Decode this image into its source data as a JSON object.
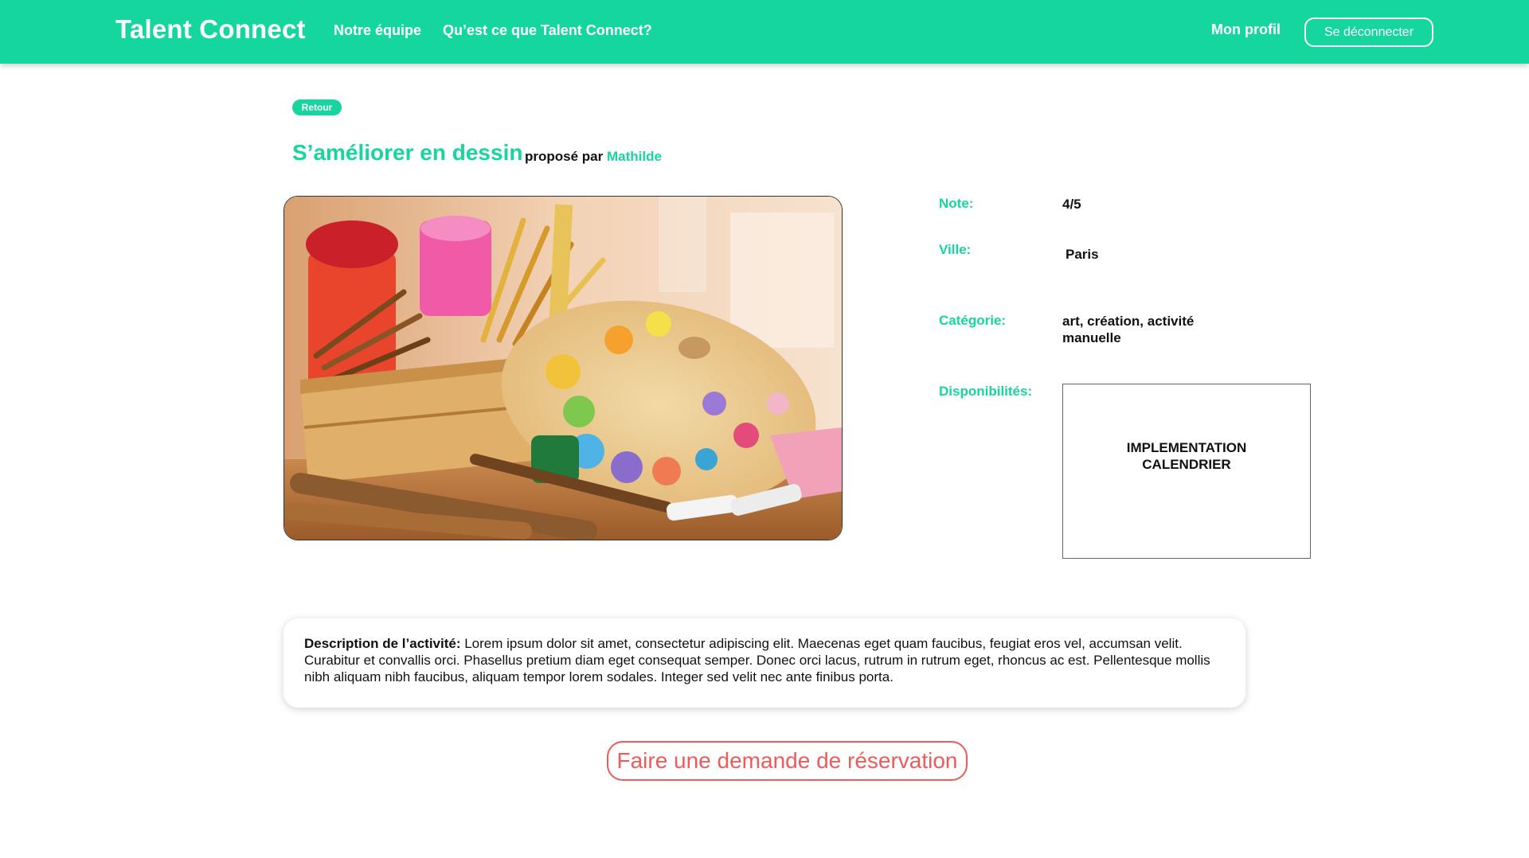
{
  "header": {
    "brand": "Talent Connect",
    "nav": {
      "team": "Notre équipe",
      "about": "Qu’est ce que Talent Connect?"
    },
    "profile": "Mon profil",
    "logout": "Se déconnecter"
  },
  "back_label": "Retour",
  "activity": {
    "title": "S’améliorer en dessin",
    "proposed_by": "proposé par",
    "author": "Mathilde",
    "image_icon": "art-supplies-photo"
  },
  "info": {
    "note_label": "Note:",
    "note_value": "4/5",
    "city_label": "Ville:",
    "city_value": "Paris",
    "category_label": "Catégorie:",
    "category_value_line1": "art, création, activité",
    "category_value_line2": "manuelle",
    "availability_label": "Disponibilités:",
    "calendar_line1": "IMPLEMENTATION",
    "calendar_line2": "CALENDRIER"
  },
  "description": {
    "label": "Description de l’activité:",
    "text": " Lorem ipsum dolor sit amet, consectetur adipiscing elit. Maecenas eget quam faucibus, feugiat eros vel, accumsan velit. Curabitur et convallis orci. Phasellus pretium diam eget consequat semper. Donec orci lacus, rutrum in rutrum eget, rhoncus ac est. Pellentesque mollis nibh aliquam nibh faucibus, aliquam tempor lorem sodales. Integer sed velit nec ante finibus porta."
  },
  "cta": "Faire une demande de réservation",
  "colors": {
    "brand": "#16d6a0",
    "cta": "#ef5a5a"
  }
}
